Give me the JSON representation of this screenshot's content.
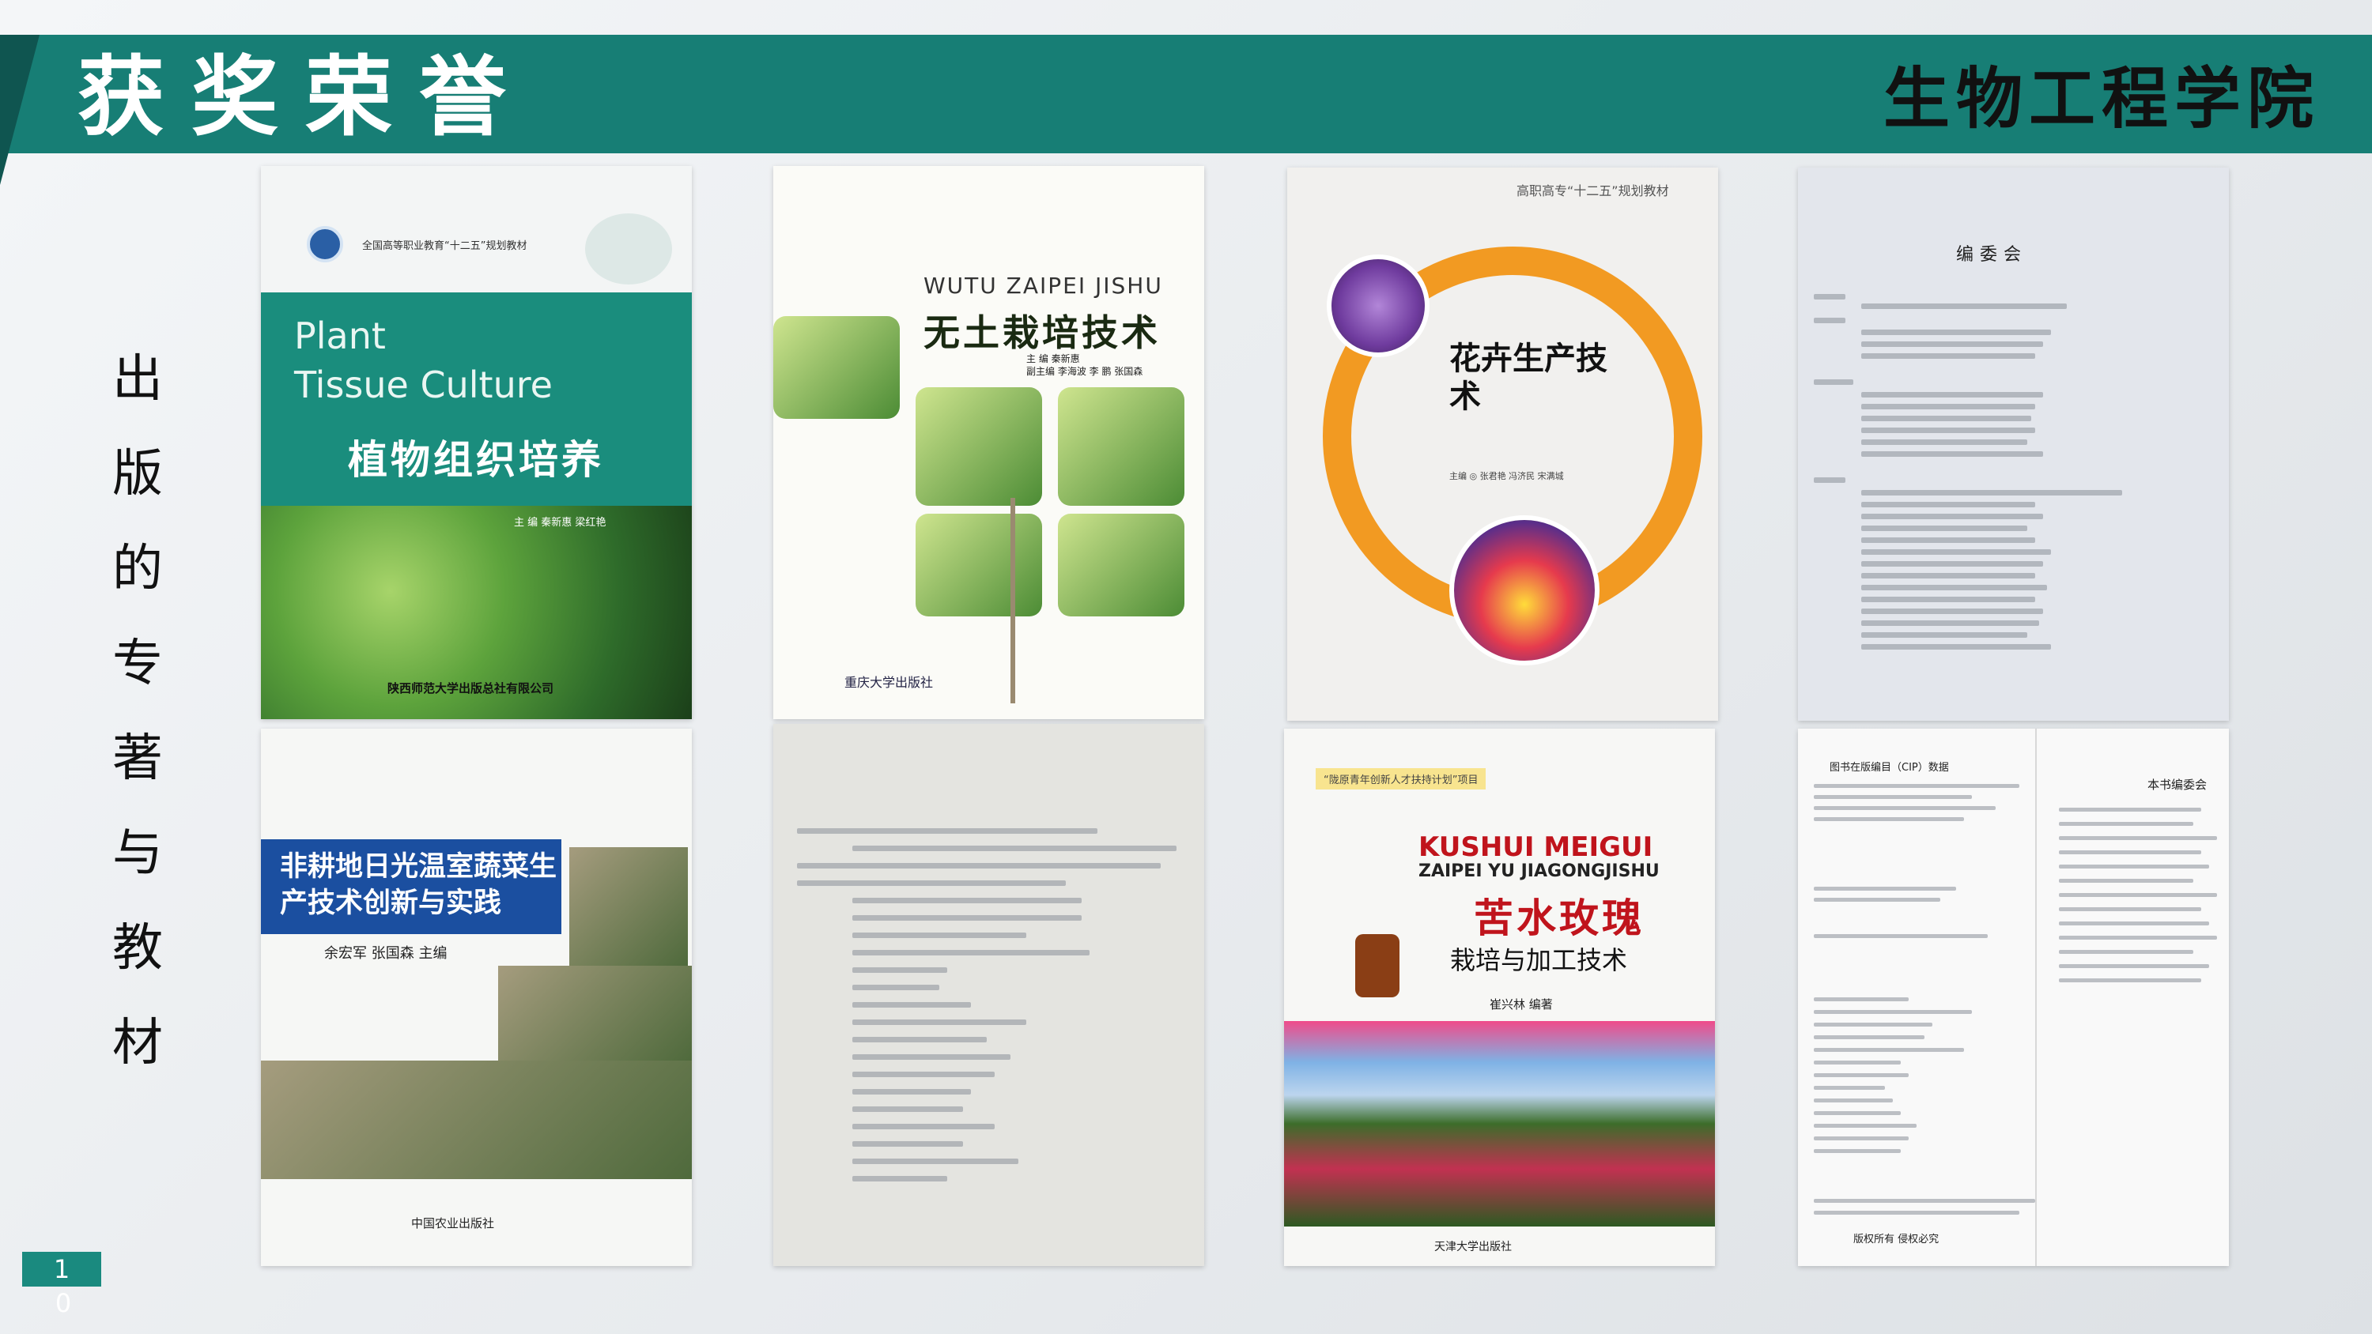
{
  "header": {
    "title": "获奖荣誉",
    "college": "生物工程学院"
  },
  "side_caption": "出版的专著与教材",
  "page_number": {
    "line1": "1",
    "line2": "0"
  },
  "books": {
    "b1": {
      "series": "全国高等职业教育“十二五”规划教材",
      "title_en_1": "Plant",
      "title_en_2": "Tissue Culture",
      "title_cn": "植物组织培养",
      "author": "主 编  秦新惠  梁红艳",
      "publisher": "陕西师范大学出版总社有限公司"
    },
    "b2": {
      "title_en": "WUTU ZAIPEI JISHU",
      "title_cn": "无土栽培技术",
      "author_1": "主  编  秦新惠",
      "author_2": "副主编  李海波  李 鹏  张国森",
      "publisher": "重庆大学出版社"
    },
    "b3": {
      "series": "高职高专“十二五”规划教材",
      "title_cn": "花卉生产技术",
      "author": "主编 ◎ 张君艳  冯济民  宋满城"
    },
    "b4": {
      "heading": "编委会"
    },
    "b5": {
      "title_cn": "非耕地日光温室蔬菜生产技术创新与实践",
      "author": "余宏军  张国森  主编",
      "publisher": "中国农业出版社"
    },
    "b7": {
      "project": "“陇原青年创新人才扶持计划”项目",
      "title_en_1": "KUSHUI MEIGUI",
      "title_en_2": "ZAIPEI YU JIAGONGJISHU",
      "title_cn": "苦水玫瑰",
      "subtitle_cn": "栽培与加工技术",
      "author": "崔兴林  编著",
      "publisher": "天津大学出版社"
    },
    "b8": {
      "cip": "图书在版编目（CIP）数据",
      "editors": "本书编委会",
      "footer": "版权所有  侵权必究"
    }
  }
}
